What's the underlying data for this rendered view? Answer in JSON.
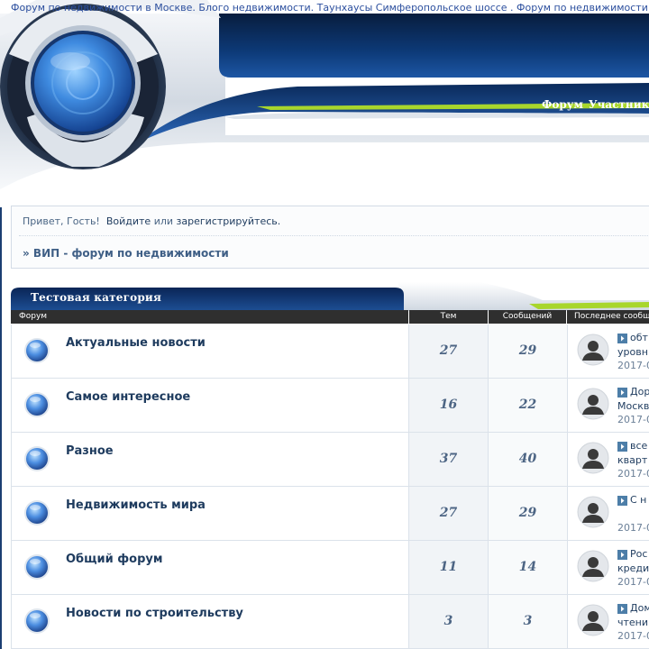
{
  "header": {
    "marquee": "Форум по недвижимости в Москве. Блого недвижимости. Таунхаусы Симферопольское шоссе . Форум по недвижимости",
    "nav": [
      "Форум",
      "Участники"
    ]
  },
  "greeting": {
    "hello": "Привет, Гость!",
    "login": "Войдите",
    "or": "или",
    "register": "зарегистрируйтесь."
  },
  "breadcrumb": "» ВИП - форум по недвижимости",
  "category": {
    "title": "Тестовая категория",
    "columns": {
      "forum": "Форум",
      "topics": "Тем",
      "posts": "Сообщений",
      "last": "Последнее сообщение"
    }
  },
  "forums": [
    {
      "name": "Актуальные новости",
      "topics": "27",
      "posts": "29",
      "last_title": "обт",
      "last_sub": "уровн",
      "last_date": "2017-0"
    },
    {
      "name": "Самое интересное",
      "topics": "16",
      "posts": "22",
      "last_title": "Дор",
      "last_sub": "Москв",
      "last_date": "2017-0"
    },
    {
      "name": "Разное",
      "topics": "37",
      "posts": "40",
      "last_title": "все",
      "last_sub": "кварт",
      "last_date": "2017-0"
    },
    {
      "name": "Недвижимость мира",
      "topics": "27",
      "posts": "29",
      "last_title": "С н",
      "last_sub": "",
      "last_date": "2017-0"
    },
    {
      "name": "Общий форум",
      "topics": "11",
      "posts": "14",
      "last_title": "Рос",
      "last_sub": "креди",
      "last_date": "2017-0"
    },
    {
      "name": "Новости по строительству",
      "topics": "3",
      "posts": "3",
      "last_title": "Дом",
      "last_sub": "чтени",
      "last_date": "2017-0"
    }
  ],
  "colors": {
    "header_navy": "#0b2f62",
    "accent_green": "#a8d62c",
    "text_primary": "#1e3b5e"
  }
}
